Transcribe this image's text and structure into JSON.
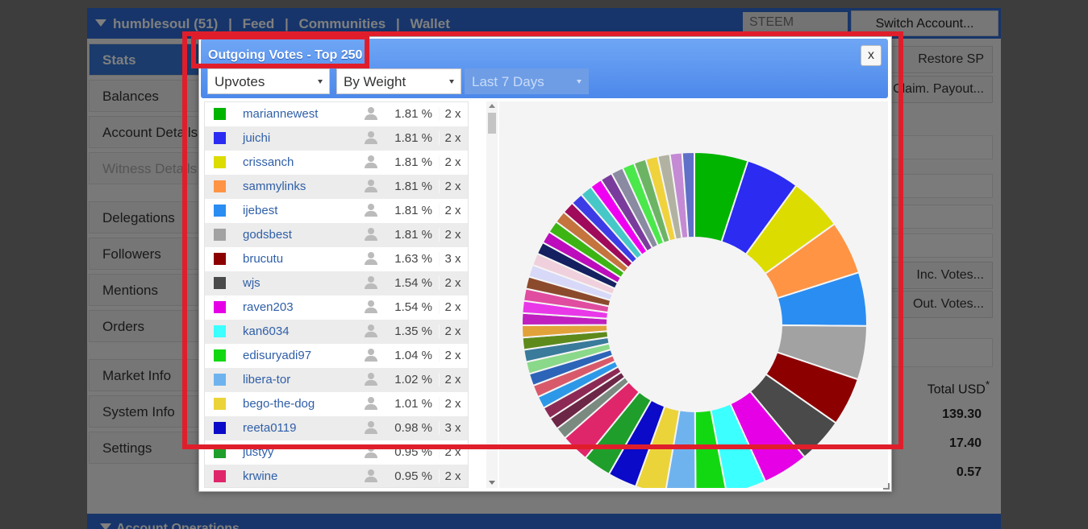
{
  "topbar": {
    "account": "humblesoul (51)",
    "sep": "|",
    "feed": "Feed",
    "communities": "Communities",
    "wallet": "Wallet",
    "currency": "STEEM",
    "switch_account": "Switch Account..."
  },
  "sidebar": {
    "items": [
      {
        "label": "Stats"
      },
      {
        "label": "Balances"
      },
      {
        "label": "Account Details"
      },
      {
        "label": "Witness Details"
      },
      {
        "label": "Delegations"
      },
      {
        "label": "Followers"
      },
      {
        "label": "Mentions"
      },
      {
        "label": "Orders"
      },
      {
        "label": "Market Info"
      },
      {
        "label": "System Info"
      },
      {
        "label": "Settings"
      }
    ]
  },
  "right_panel": {
    "restore_sp": "Restore SP",
    "claim_payout": "Claim. Payout...",
    "inc_votes": "Inc. Votes...",
    "out_votes": "Out. Votes...",
    "total_usd": "Total USD",
    "asterisk": "*",
    "values": [
      "139.30",
      "17.40",
      "0.57"
    ]
  },
  "bottombar": {
    "title": "Account Operations"
  },
  "modal": {
    "title": "Outgoing Votes - Top 250",
    "close": "x",
    "filter_type": "Upvotes",
    "sort": "By Weight",
    "period": "Last 7 Days"
  },
  "votes": [
    {
      "name": "mariannewest",
      "pct": "1.81 %",
      "count": "2 x",
      "color": "#00b400"
    },
    {
      "name": "juichi",
      "pct": "1.81 %",
      "count": "2 x",
      "color": "#2b2bf2"
    },
    {
      "name": "crissanch",
      "pct": "1.81 %",
      "count": "2 x",
      "color": "#dcdc00"
    },
    {
      "name": "sammylinks",
      "pct": "1.81 %",
      "count": "2 x",
      "color": "#ff9444"
    },
    {
      "name": "ijebest",
      "pct": "1.81 %",
      "count": "2 x",
      "color": "#2a8df2"
    },
    {
      "name": "godsbest",
      "pct": "1.81 %",
      "count": "2 x",
      "color": "#a2a2a2"
    },
    {
      "name": "brucutu",
      "pct": "1.63 %",
      "count": "3 x",
      "color": "#8c0000"
    },
    {
      "name": "wjs",
      "pct": "1.54 %",
      "count": "2 x",
      "color": "#4a4a4a"
    },
    {
      "name": "raven203",
      "pct": "1.54 %",
      "count": "2 x",
      "color": "#e600e6"
    },
    {
      "name": "kan6034",
      "pct": "1.35 %",
      "count": "2 x",
      "color": "#3cffff"
    },
    {
      "name": "edisuryadi97",
      "pct": "1.04 %",
      "count": "2 x",
      "color": "#12d812"
    },
    {
      "name": "libera-tor",
      "pct": "1.02 %",
      "count": "2 x",
      "color": "#6fb3ee"
    },
    {
      "name": "bego-the-dog",
      "pct": "1.01 %",
      "count": "2 x",
      "color": "#ebd43a"
    },
    {
      "name": "reeta0119",
      "pct": "0.98 %",
      "count": "3 x",
      "color": "#0a0ac8"
    },
    {
      "name": "justyy",
      "pct": "0.95 %",
      "count": "2 x",
      "color": "#1f9e2c"
    },
    {
      "name": "krwine",
      "pct": "0.95 %",
      "count": "2 x",
      "color": "#e0266a"
    }
  ],
  "extra_slice_colors": [
    "#7a8a80",
    "#6c2646",
    "#8c2a55",
    "#2e98e8",
    "#d85a6a",
    "#2c64b8",
    "#8ad88a",
    "#3a7a9a",
    "#5e8a1c",
    "#e2a23a",
    "#c020c0",
    "#e838e8",
    "#e04ca0",
    "#8c4a2c",
    "#d8d8f8",
    "#f0d0dc",
    "#142060",
    "#bc0cbc",
    "#3cb414",
    "#c4743c",
    "#a00a5a",
    "#3c3ce6",
    "#46c8c8",
    "#f000f0",
    "#7a3c9c",
    "#8a8aa2",
    "#4ae84a",
    "#6cb464",
    "#f0d23c",
    "#b2b2a2",
    "#c48ad4",
    "#6070c8"
  ]
}
